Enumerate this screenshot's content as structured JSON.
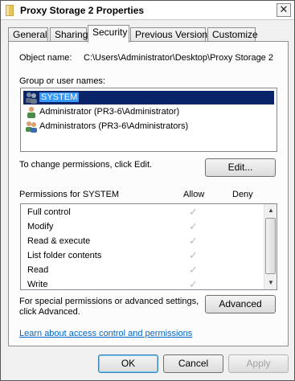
{
  "window": {
    "title": "Proxy Storage 2 Properties",
    "close_label": "✕"
  },
  "tabs": [
    {
      "label": "General"
    },
    {
      "label": "Sharing"
    },
    {
      "label": "Security",
      "active": true
    },
    {
      "label": "Previous Versions"
    },
    {
      "label": "Customize"
    }
  ],
  "security": {
    "object_name_label": "Object name:",
    "object_name_value": "C:\\Users\\Administrator\\Desktop\\Proxy Storage 2",
    "group_label": "Group or user names:",
    "users": [
      {
        "name": "SYSTEM",
        "icon": "users-group-icon",
        "selected": true
      },
      {
        "name": "Administrator (PR3-6\\Administrator)",
        "icon": "user-icon"
      },
      {
        "name": "Administrators (PR3-6\\Administrators)",
        "icon": "users-group-icon"
      }
    ],
    "change_text": "To change permissions, click Edit.",
    "edit_button": "Edit...",
    "permissions_label": "Permissions for SYSTEM",
    "allow_header": "Allow",
    "deny_header": "Deny",
    "permissions": [
      {
        "name": "Full control",
        "allow": true,
        "deny": false
      },
      {
        "name": "Modify",
        "allow": true,
        "deny": false
      },
      {
        "name": "Read & execute",
        "allow": true,
        "deny": false
      },
      {
        "name": "List folder contents",
        "allow": true,
        "deny": false
      },
      {
        "name": "Read",
        "allow": true,
        "deny": false
      },
      {
        "name": "Write",
        "allow": true,
        "deny": false
      }
    ],
    "special_text_line1": "For special permissions or advanced settings,",
    "special_text_line2": "click Advanced.",
    "advanced_button": "Advanced",
    "learn_link": "Learn about access control and permissions"
  },
  "buttons": {
    "ok": "OK",
    "cancel": "Cancel",
    "apply": "Apply"
  },
  "colors": {
    "selection": "#3399ff",
    "link": "#0066cc",
    "check": "#b8b8b8"
  }
}
